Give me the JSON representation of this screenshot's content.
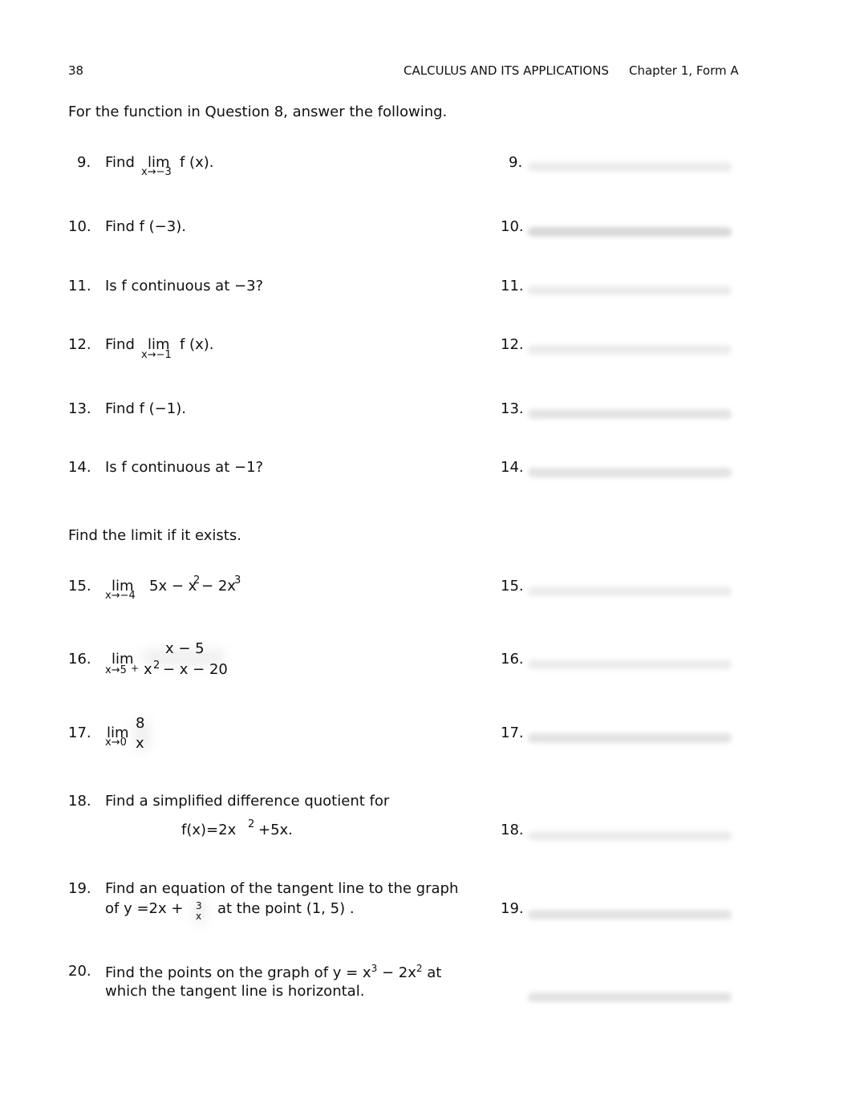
{
  "header": {
    "page_number": "38",
    "book_title": "CALCULUS AND ITS APPLICATIONS",
    "chapter": "Chapter 1, Form A"
  },
  "sections": [
    {
      "instruction": "For the function in Question 8, answer the following."
    },
    {
      "instruction": "Find the limit if it exists."
    }
  ],
  "questions": [
    {
      "number": "9.",
      "prefix": "Find",
      "lim": "lim",
      "lim_sub": "x→−3",
      "suffix": "f (x).",
      "answer_label": "9."
    },
    {
      "number": "10.",
      "text": "Find f (−3).",
      "answer_label": "10."
    },
    {
      "number": "11.",
      "text": "Is f continuous at −3?",
      "answer_label": "11."
    },
    {
      "number": "12.",
      "prefix": "Find",
      "lim": "lim",
      "lim_sub": "x→−1",
      "suffix": "f (x).",
      "answer_label": "12."
    },
    {
      "number": "13.",
      "text": "Find f (−1).",
      "answer_label": "13."
    },
    {
      "number": "14.",
      "text": "Is f continuous at −1?",
      "answer_label": "14."
    },
    {
      "number": "15.",
      "lim": "lim",
      "lim_sub": "x→−4",
      "expr_a": "5x − x",
      "exp_a": "2",
      "expr_b": " − 2x",
      "exp_b": "3",
      "answer_label": "15."
    },
    {
      "number": "16.",
      "lim": "lim",
      "lim_sub": "x→5",
      "lim_sub_sup": "+",
      "numerator": "x − 5",
      "denominator_a": "x",
      "denominator_exp": "2",
      "denominator_b": "− x − 20",
      "answer_label": "16."
    },
    {
      "number": "17.",
      "lim": "lim",
      "lim_sub": "x→0",
      "numerator": "8",
      "denominator": "x",
      "answer_label": "17."
    },
    {
      "number": "18.",
      "text": "Find a simplified difference quotient for",
      "formula_a": "f(x)=2x",
      "formula_exp": "2",
      "formula_b": "+5x.",
      "answer_label": "18."
    },
    {
      "number": "19.",
      "line1": "Find an equation of the tangent line to the graph",
      "line2_a": "of y =2x +",
      "frac_num": "3",
      "frac_den": "x",
      "line2_b": "at the point (1, 5) .",
      "answer_label": "19."
    },
    {
      "number": "20.",
      "line1_a": "Find the points on the graph of y = x",
      "exp_1": "3",
      "line1_b": " − 2x",
      "exp_2": "2",
      "line1_c": " at",
      "line2": "which the tangent line is horizontal.",
      "answer_label": ""
    }
  ]
}
